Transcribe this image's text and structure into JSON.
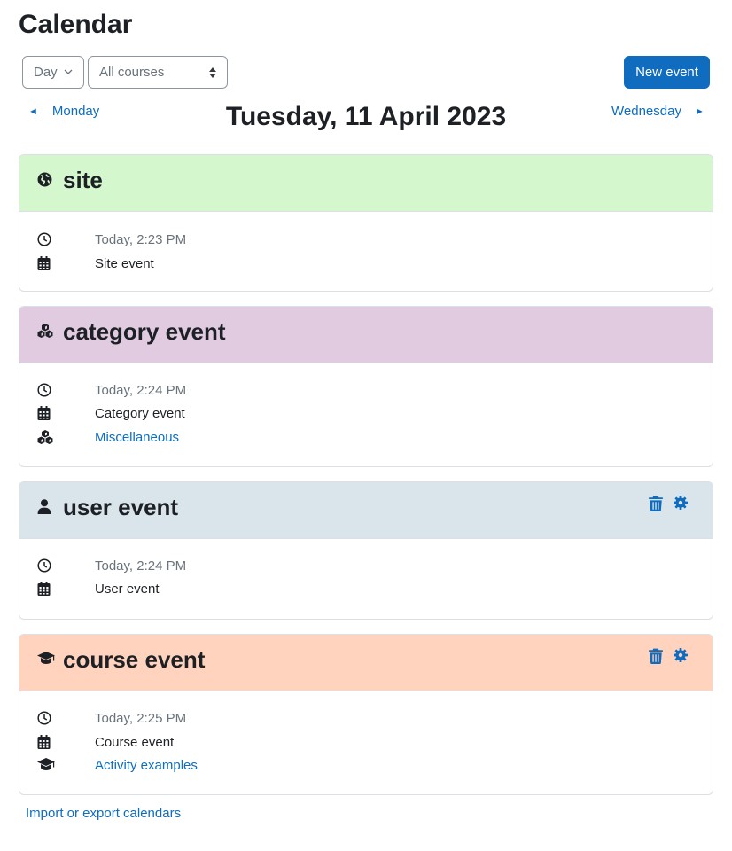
{
  "page": {
    "title": "Calendar"
  },
  "controls": {
    "view_select": "Day",
    "course_select": "All courses",
    "new_event_label": "New event"
  },
  "navigation": {
    "prev_label": "Monday",
    "next_label": "Wednesday",
    "current_date": "Tuesday, 11 April 2023"
  },
  "events": [
    {
      "title": "site",
      "header_color": "#d4f7cd",
      "type_icon": "globe-icon",
      "time": "Today, 2:23 PM",
      "name": "Site event",
      "has_actions": false
    },
    {
      "title": "category event",
      "header_color": "#e1cbe0",
      "type_icon": "cubes-icon",
      "time": "Today, 2:24 PM",
      "name": "Category event",
      "context": "Miscellaneous",
      "has_actions": false
    },
    {
      "title": "user event",
      "header_color": "#dae5eb",
      "type_icon": "user-icon",
      "time": "Today, 2:24 PM",
      "name": "User event",
      "has_actions": true
    },
    {
      "title": "course event",
      "header_color": "#ffd3bd",
      "type_icon": "graduation-cap-icon",
      "time": "Today, 2:25 PM",
      "name": "Course event",
      "context": "Activity examples",
      "has_actions": true
    }
  ],
  "footer": {
    "import_export_label": "Import or export calendars"
  },
  "colors": {
    "accent": "#0f6cbf",
    "border": "#dcdfe3",
    "text": "#1d2125",
    "muted": "#6a737b"
  }
}
